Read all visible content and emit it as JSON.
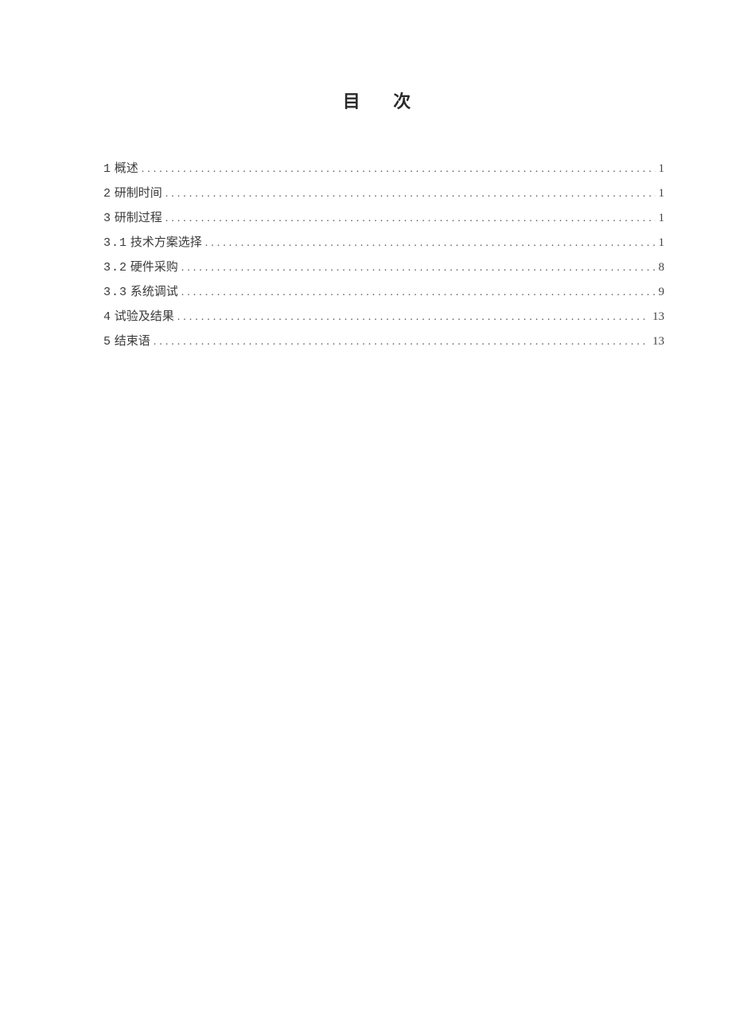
{
  "title": "目 次",
  "toc": [
    {
      "num": "1",
      "label": "概述",
      "page": "1"
    },
    {
      "num": "2",
      "label": "研制时间",
      "page": "1"
    },
    {
      "num": "3",
      "label": "研制过程",
      "page": "1"
    },
    {
      "num": "3.1",
      "label": "技术方案选择",
      "page": "1"
    },
    {
      "num": "3.2",
      "label": "硬件采购",
      "page": "8"
    },
    {
      "num": "3.3",
      "label": "系统调试",
      "page": "9"
    },
    {
      "num": "4",
      "label": "试验及结果",
      "page": "13"
    },
    {
      "num": "5",
      "label": "结束语",
      "page": "13"
    }
  ]
}
